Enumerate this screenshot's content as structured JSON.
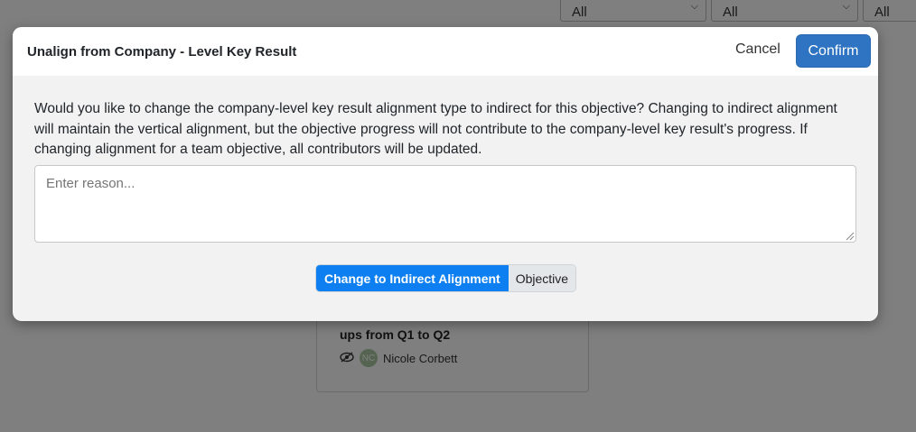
{
  "background": {
    "filters": [
      {
        "value": "All"
      },
      {
        "value": "All"
      },
      {
        "value": "All"
      }
    ],
    "card": {
      "title": "ups from Q1 to Q2",
      "owner_initials": "NC",
      "owner_name": "Nicole Corbett"
    }
  },
  "modal": {
    "title": "Unalign from Company - Level Key Result",
    "cancel_label": "Cancel",
    "confirm_label": "Confirm",
    "message": "Would you like to change the company-level key result alignment type to indirect for this objective? Changing to indirect alignment will maintain the vertical alignment, but the objective progress will not contribute to the company-level key result's progress. If changing alignment for a team objective, all contributors will be updated.",
    "reason_placeholder": "Enter reason...",
    "reason_value": "",
    "toggle": {
      "active_label": "Change to Indirect Alignment",
      "inactive_label": "Objective"
    }
  },
  "colors": {
    "primary": "#2f74c2",
    "toggle_active": "#0d7ff0",
    "modal_bg": "#f2f2f2",
    "overlay": "rgba(0,0,0,0.5)"
  }
}
